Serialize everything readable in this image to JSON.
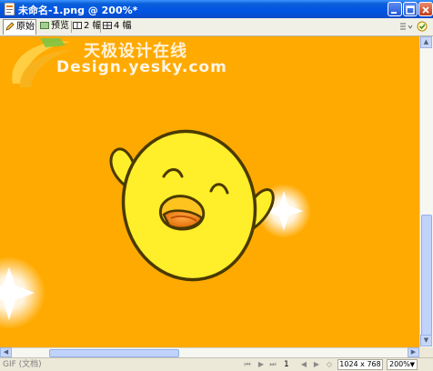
{
  "window": {
    "title": "未命名-1.png @ 200%*"
  },
  "tabs": [
    {
      "label": "原始",
      "active": true
    },
    {
      "label": "预览",
      "active": false
    },
    {
      "label": "2 幅",
      "active": false
    },
    {
      "label": "4 幅",
      "active": false
    }
  ],
  "watermark": {
    "line1": "天极设计在线",
    "line2": "Design.yesky.com"
  },
  "status": {
    "left": "GIF (文档)",
    "page": "1",
    "dimensions": "1024 x 768",
    "zoom": "200%"
  },
  "colors": {
    "canvas": "#ffaa00",
    "titlebar": "#0054e3",
    "chick_body": "#ffee2a"
  }
}
